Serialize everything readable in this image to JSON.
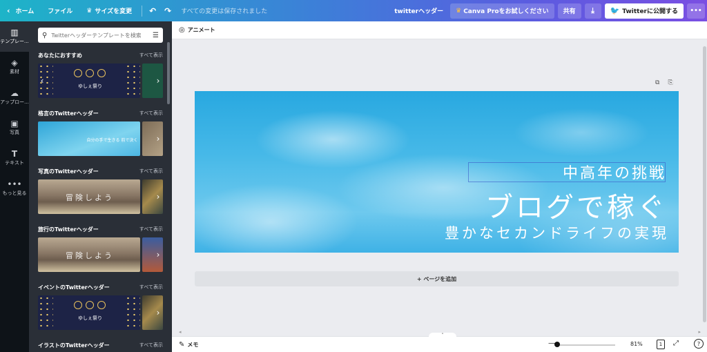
{
  "topbar": {
    "home_label": "ホーム",
    "file_label": "ファイル",
    "resize_label": "サイズを変更",
    "saved_status": "すべての変更は保存されました",
    "doc_title": "twitterヘッダー",
    "pro_label": "Canva Proをお試しください",
    "share_label": "共有",
    "publish_label": "Twitterに公開する"
  },
  "rail": {
    "items": [
      {
        "label": "テンプレー..."
      },
      {
        "label": "素材"
      },
      {
        "label": "アップロー..."
      },
      {
        "label": "写真"
      },
      {
        "label": "テキスト"
      },
      {
        "label": "もっと見る"
      }
    ]
  },
  "panel": {
    "search_placeholder": "Twitterヘッダーテンプレートを検索",
    "see_all": "すべて表示",
    "sections": [
      {
        "title": "あなたにおすすめ"
      },
      {
        "title": "格言のTwitterヘッダー"
      },
      {
        "title": "写真のTwitterヘッダー"
      },
      {
        "title": "旅行のTwitterヘッダー"
      },
      {
        "title": "イベントのTwitterヘッダー"
      },
      {
        "title": "イラストのTwitterヘッダー"
      }
    ],
    "thumb_texts": {
      "rec_main": "ゆしぇ祭り",
      "quote_main": "自分の手で生きる 前で決く",
      "photo_main": "冒険しよう",
      "travel_main": "冒険しよう",
      "event_main": "ゆしぇ祭り"
    }
  },
  "toolbar": {
    "animate_label": "アニメート"
  },
  "canvas": {
    "line1": "中高年の挑戦",
    "line2": "ブログで稼ぐ",
    "line3": "豊かなセカンドライフの実現"
  },
  "workspace": {
    "add_page_label": "+ ページを追加"
  },
  "bottombar": {
    "memo_label": "メモ",
    "zoom_label": "81%",
    "page_count": "1"
  }
}
